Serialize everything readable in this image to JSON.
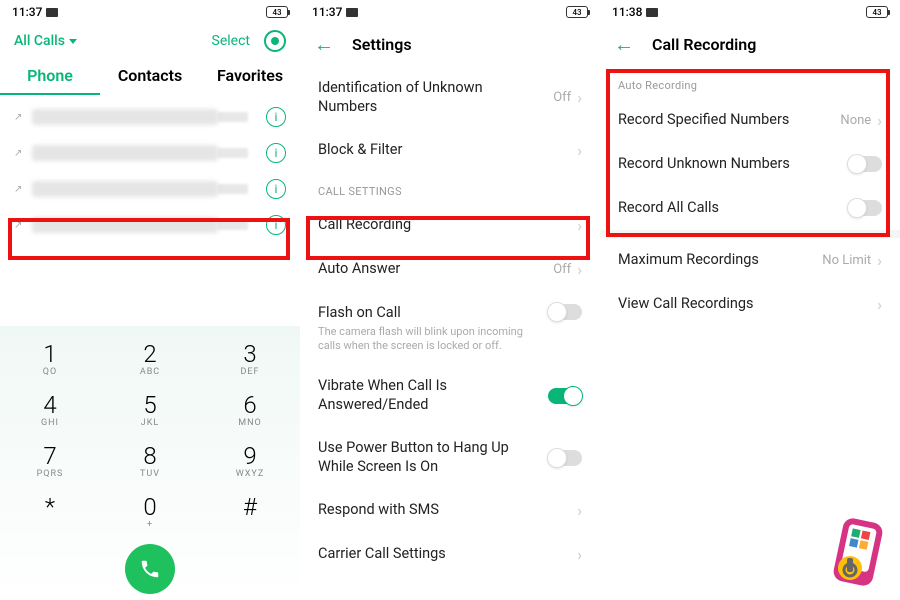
{
  "s1": {
    "time": "11:37",
    "battery": "43",
    "all_calls": "All Calls",
    "select": "Select",
    "tabs": {
      "phone": "Phone",
      "contacts": "Contacts",
      "favorites": "Favorites"
    },
    "keys": [
      {
        "n": "1",
        "l": "QO"
      },
      {
        "n": "2",
        "l": "ABC"
      },
      {
        "n": "3",
        "l": "DEF"
      },
      {
        "n": "4",
        "l": "GHI"
      },
      {
        "n": "5",
        "l": "JKL"
      },
      {
        "n": "6",
        "l": "MNO"
      },
      {
        "n": "7",
        "l": "PQRS"
      },
      {
        "n": "8",
        "l": "TUV"
      },
      {
        "n": "9",
        "l": "WXYZ"
      },
      {
        "n": "*",
        "l": ""
      },
      {
        "n": "0",
        "l": "+"
      },
      {
        "n": "#",
        "l": ""
      }
    ]
  },
  "s2": {
    "time": "11:37",
    "battery": "43",
    "title": "Settings",
    "rows": {
      "id_unknown": "Identification of Unknown Numbers",
      "id_unknown_val": "Off",
      "block": "Block & Filter",
      "section": "CALL SETTINGS",
      "call_rec": "Call Recording",
      "auto_ans": "Auto Answer",
      "auto_ans_val": "Off",
      "flash": "Flash on Call",
      "flash_sub": "The camera flash will blink upon incoming calls when the screen is locked or off.",
      "vibrate": "Vibrate When Call Is Answered/Ended",
      "power": "Use Power Button to Hang Up While Screen Is On",
      "sms": "Respond with SMS",
      "carrier": "Carrier Call Settings"
    }
  },
  "s3": {
    "time": "11:38",
    "battery": "43",
    "title": "Call Recording",
    "section": "Auto Recording",
    "rows": {
      "spec": "Record Specified Numbers",
      "spec_val": "None",
      "unknown": "Record Unknown Numbers",
      "all": "Record All Calls",
      "max": "Maximum Recordings",
      "max_val": "No Limit",
      "view": "View Call Recordings"
    }
  }
}
